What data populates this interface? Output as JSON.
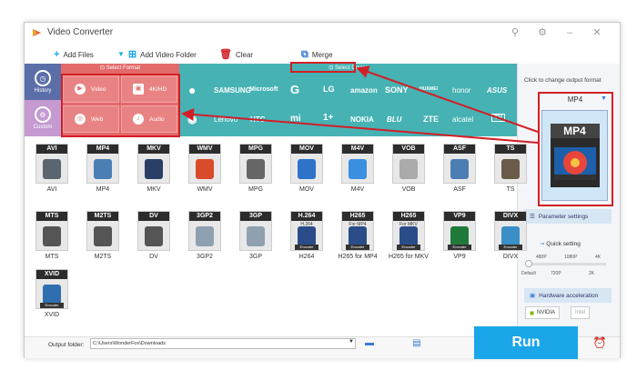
{
  "app": {
    "title": "Video Converter"
  },
  "toolbar": {
    "add_files": "Add Files",
    "add_video_folder": "Add Video Folder",
    "clear": "Clear",
    "merge": "Merge"
  },
  "leftnav": {
    "history": "History",
    "custom": "Custom"
  },
  "format_panel": {
    "header": "Select Format",
    "tiles": [
      {
        "label": "Video"
      },
      {
        "label": "4K/HD"
      },
      {
        "label": "Web"
      },
      {
        "label": "Audio"
      }
    ]
  },
  "device_panel": {
    "header": "Select Device",
    "row1": [
      "",
      "SAMSUNG",
      "Microsoft",
      "G",
      "LG",
      "amazon",
      "SONY",
      "HUAWEI",
      "honor",
      "ASUS"
    ],
    "row2": [
      "",
      "Lenovo",
      "HTC",
      "mi",
      "1+",
      "NOKIA",
      "BLU",
      "ZTE",
      "alcatel",
      "TV"
    ]
  },
  "output_panel": {
    "hint": "Click to change output format",
    "format": "MP4",
    "tile_label": "MP4",
    "parameter_settings": "Parameter settings",
    "quick_setting": "Quick setting",
    "quality_top": [
      "480P",
      "1080P",
      "4K"
    ],
    "quality_bottom": [
      "Default",
      "720P",
      "2K"
    ],
    "hardware_acceleration": "Hardware acceleration",
    "nvidia": "NVIDIA",
    "intel": "Intel"
  },
  "formats": [
    {
      "tag": "AVI",
      "sub": "",
      "cap": "AVI",
      "color": "#5a6570",
      "enc": ""
    },
    {
      "tag": "MP4",
      "sub": "",
      "cap": "MP4",
      "color": "#4b7fb3",
      "enc": ""
    },
    {
      "tag": "MKV",
      "sub": "",
      "cap": "MKV",
      "color": "#2a3f66",
      "enc": ""
    },
    {
      "tag": "WMV",
      "sub": "",
      "cap": "WMV",
      "color": "#d94c2b",
      "enc": ""
    },
    {
      "tag": "MPG",
      "sub": "",
      "cap": "MPG",
      "color": "#666666",
      "enc": ""
    },
    {
      "tag": "MOV",
      "sub": "",
      "cap": "MOV",
      "color": "#2f72c9",
      "enc": ""
    },
    {
      "tag": "M4V",
      "sub": "",
      "cap": "M4V",
      "color": "#3a8fe0",
      "enc": ""
    },
    {
      "tag": "VOB",
      "sub": "",
      "cap": "VOB",
      "color": "#aaaaaa",
      "enc": ""
    },
    {
      "tag": "ASF",
      "sub": "",
      "cap": "ASF",
      "color": "#4b7fb3",
      "enc": ""
    },
    {
      "tag": "TS",
      "sub": "",
      "cap": "TS",
      "color": "#6b5b4a",
      "enc": ""
    },
    {
      "tag": "MTS",
      "sub": "",
      "cap": "MTS",
      "color": "#555555",
      "enc": ""
    },
    {
      "tag": "M2TS",
      "sub": "",
      "cap": "M2TS",
      "color": "#555555",
      "enc": ""
    },
    {
      "tag": "DV",
      "sub": "",
      "cap": "DV",
      "color": "#555555",
      "enc": ""
    },
    {
      "tag": "3GP2",
      "sub": "",
      "cap": "3GP2",
      "color": "#8fa0b0",
      "enc": ""
    },
    {
      "tag": "3GP",
      "sub": "",
      "cap": "3GP",
      "color": "#8fa0b0",
      "enc": ""
    },
    {
      "tag": "H.264",
      "sub": "H.264",
      "cap": "H264",
      "color": "#2a4d8a",
      "enc": "Encoder"
    },
    {
      "tag": "H265",
      "sub": "For MP4",
      "cap": "H265 for MP4",
      "color": "#2a4d8a",
      "enc": "Encoder"
    },
    {
      "tag": "H265",
      "sub": "For MKV",
      "cap": "H265 for MKV",
      "color": "#2a4d8a",
      "enc": "Encoder"
    },
    {
      "tag": "VP9",
      "sub": "",
      "cap": "VP9",
      "color": "#1f7a3a",
      "enc": "Encoder"
    },
    {
      "tag": "DIVX",
      "sub": "",
      "cap": "DIVX",
      "color": "#3a8fc7",
      "enc": "Encoder"
    },
    {
      "tag": "XVID",
      "sub": "",
      "cap": "XVID",
      "color": "#2f6fb0",
      "enc": "Encoder"
    }
  ],
  "bottom": {
    "output_folder_label": "Output folder:",
    "output_folder_value": "C:\\Users\\WonderFox\\Downloads",
    "run": "Run"
  },
  "colors": {
    "format_panel": "#e36a6a",
    "device_panel": "#46b2b4",
    "run": "#1aa6e8",
    "highlight": "#d21f26"
  }
}
